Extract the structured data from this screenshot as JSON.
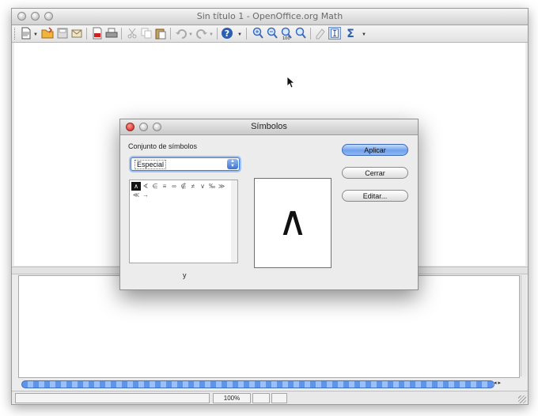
{
  "window": {
    "title": "Sin título 1 - OpenOffice.org Math",
    "traffic_lights": [
      "close",
      "minimize",
      "zoom"
    ]
  },
  "toolbar": {
    "buttons": [
      {
        "name": "new-document",
        "icon": "new-document-icon"
      },
      {
        "name": "open",
        "icon": "folder-open-icon"
      },
      {
        "name": "save",
        "icon": "save-icon"
      },
      {
        "name": "email",
        "icon": "email-icon"
      },
      {
        "name": "export-pdf",
        "icon": "pdf-icon"
      },
      {
        "name": "print",
        "icon": "printer-icon"
      },
      {
        "name": "cut",
        "icon": "scissors-icon"
      },
      {
        "name": "copy",
        "icon": "copy-icon"
      },
      {
        "name": "paste",
        "icon": "paste-icon"
      },
      {
        "name": "undo",
        "icon": "undo-icon"
      },
      {
        "name": "redo",
        "icon": "redo-icon"
      },
      {
        "name": "help",
        "icon": "help-icon"
      },
      {
        "name": "zoom-in",
        "icon": "zoom-in-icon"
      },
      {
        "name": "zoom-out",
        "icon": "zoom-out-icon"
      },
      {
        "name": "zoom-100",
        "icon": "zoom-100-icon"
      },
      {
        "name": "show-all",
        "icon": "show-all-icon"
      },
      {
        "name": "update",
        "icon": "update-icon"
      },
      {
        "name": "formula-cursor",
        "icon": "formula-cursor-icon"
      },
      {
        "name": "symbols",
        "icon": "sigma-icon"
      }
    ]
  },
  "statusbar": {
    "zoom": "100%"
  },
  "dialog": {
    "title": "Símbolos",
    "set_label": "Conjunto de símbolos",
    "set_value": "Especial",
    "symbols_row1": [
      "∧",
      "∢",
      "∈",
      "≡",
      "∞",
      "∉",
      "≠",
      "∨",
      "‰",
      "≫"
    ],
    "symbols_row2": [
      "≪",
      "→"
    ],
    "preview_symbol": "∧",
    "symbol_name": "y",
    "buttons": {
      "apply": "Aplicar",
      "close": "Cerrar",
      "edit": "Editar..."
    }
  },
  "colors": {
    "accent": "#6fa1ec",
    "progress": "#5f94e8",
    "close_light": "#e0443e"
  }
}
